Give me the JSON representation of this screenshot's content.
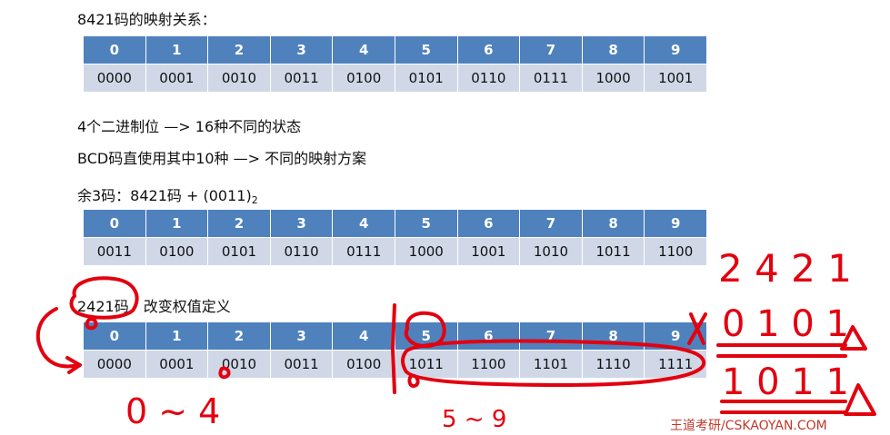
{
  "headings": {
    "mapping_8421": "8421码的映射关系：",
    "bits_line": "4个二进制位  —> 16种不同的状态",
    "bcd_line": "BCD码直使用其中10种  —> 不同的映射方案",
    "excess3_prefix": "余3码：8421码 + (0011)",
    "excess3_sub": "2",
    "code2421_label": "2421码",
    "code2421_desc": "改变权值定义"
  },
  "tables": {
    "t8421": {
      "digits": [
        "0",
        "1",
        "2",
        "3",
        "4",
        "5",
        "6",
        "7",
        "8",
        "9"
      ],
      "codes": [
        "0000",
        "0001",
        "0010",
        "0011",
        "0100",
        "0101",
        "0110",
        "0111",
        "1000",
        "1001"
      ]
    },
    "excess3": {
      "digits": [
        "0",
        "1",
        "2",
        "3",
        "4",
        "5",
        "6",
        "7",
        "8",
        "9"
      ],
      "codes": [
        "0011",
        "0100",
        "0101",
        "0110",
        "0111",
        "1000",
        "1001",
        "1010",
        "1011",
        "1100"
      ]
    },
    "t2421": {
      "digits": [
        "0",
        "1",
        "2",
        "3",
        "4",
        "5",
        "6",
        "7",
        "8",
        "9"
      ],
      "codes": [
        "0000",
        "0001",
        "0010",
        "0011",
        "0100",
        "1011",
        "1100",
        "1101",
        "1110",
        "1111"
      ]
    }
  },
  "handwritten": {
    "weights": "2 4 2 1",
    "code_upper": "0 1 0 1",
    "code_lower": "1 0 1 1",
    "note_left": "0 ~ 4",
    "note_right": "5 ~ 9",
    "cross": "X"
  },
  "colors": {
    "header_bg": "#4F81BD",
    "row_bg": "#D0D8E8",
    "ink": "#E3000F"
  },
  "watermark": "王道考研/CSKAOYAN.COM"
}
